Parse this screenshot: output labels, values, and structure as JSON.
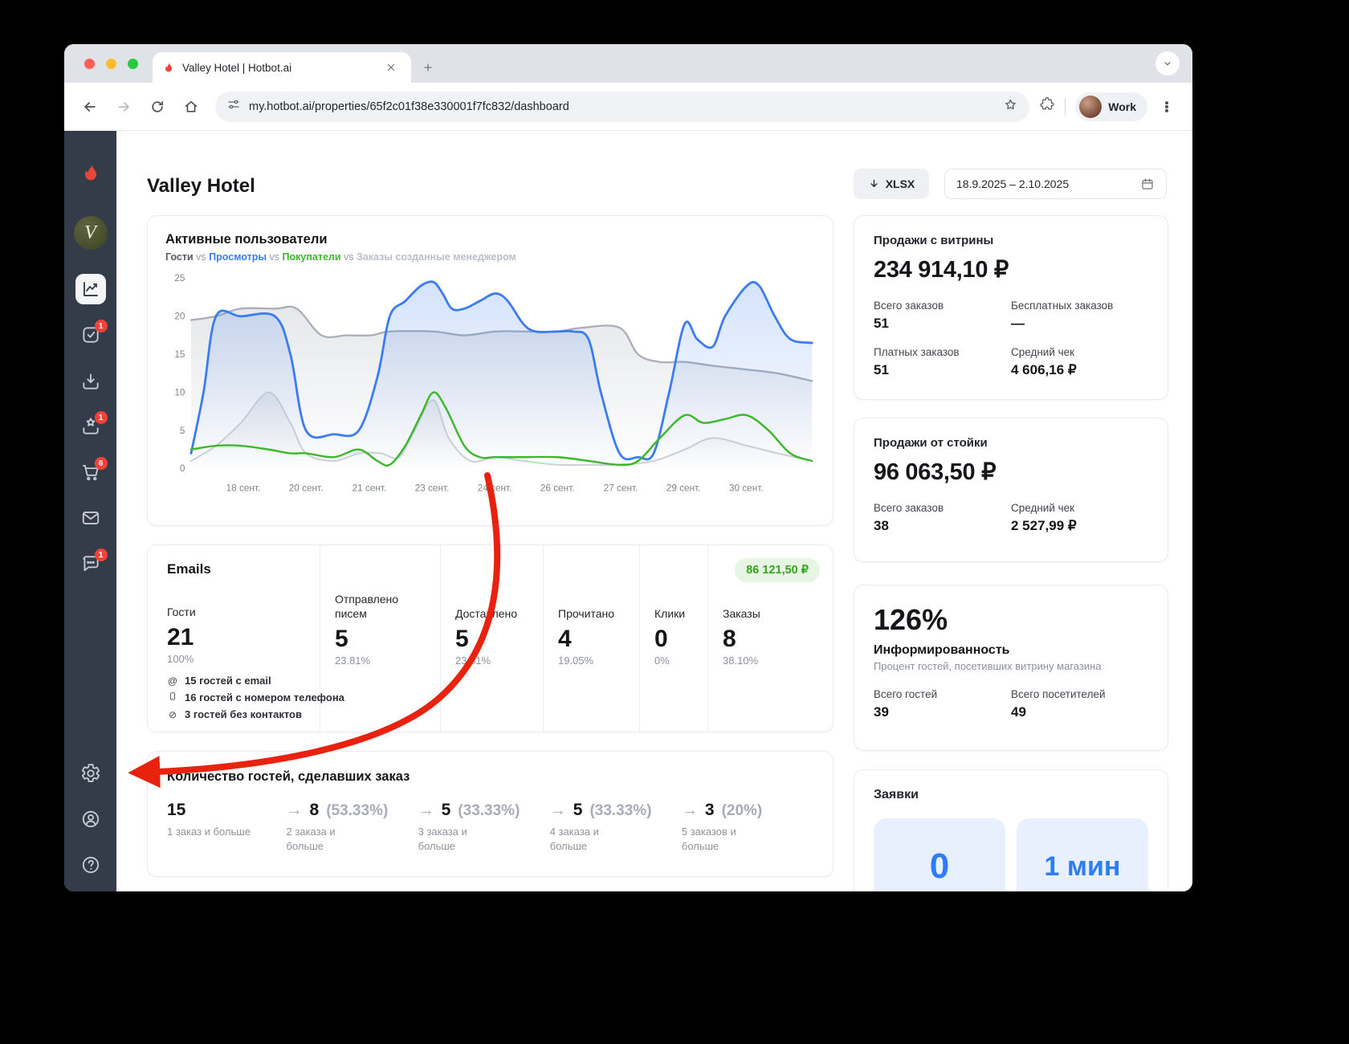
{
  "browser": {
    "tab_title": "Valley Hotel | Hotbot.ai",
    "url": "my.hotbot.ai/properties/65f2c01f38e330001f7fc832/dashboard",
    "profile_label": "Work"
  },
  "sidebar": {
    "v_label": "V",
    "badge_tasks": "1",
    "badge_reviews": "1",
    "badge_cart": "6",
    "badge_chat": "1"
  },
  "header": {
    "title": "Valley Hotel",
    "export_label": "XLSX",
    "date_range": "18.9.2025 – 2.10.2025"
  },
  "chart_data": {
    "type": "line",
    "title": "Активные пользователи",
    "vs_label": "vs",
    "ylim": [
      0,
      25
    ],
    "y_ticks": [
      0,
      5,
      10,
      15,
      20,
      25
    ],
    "x_ticks": [
      {
        "label": "18 сент.",
        "pos": 0.084
      },
      {
        "label": "20 сент.",
        "pos": 0.185
      },
      {
        "label": "21 сент.",
        "pos": 0.287
      },
      {
        "label": "23 сент.",
        "pos": 0.388
      },
      {
        "label": "24 сент.",
        "pos": 0.489
      },
      {
        "label": "26 сент.",
        "pos": 0.59
      },
      {
        "label": "27 сент.",
        "pos": 0.692
      },
      {
        "label": "29 сент.",
        "pos": 0.793
      },
      {
        "label": "30 сент.",
        "pos": 0.894
      }
    ],
    "series": [
      {
        "name": "Гости",
        "color": "#aab0ba",
        "legend_color": "#555b66",
        "width": 2.5,
        "z": 1,
        "fill": "url(#gradGray)",
        "points": [
          [
            0,
            19.5
          ],
          [
            0.04,
            20
          ],
          [
            0.08,
            21
          ],
          [
            0.135,
            21
          ],
          [
            0.17,
            21
          ],
          [
            0.21,
            17.5
          ],
          [
            0.25,
            17.5
          ],
          [
            0.29,
            17.5
          ],
          [
            0.32,
            18
          ],
          [
            0.39,
            18
          ],
          [
            0.44,
            17.5
          ],
          [
            0.49,
            18
          ],
          [
            0.545,
            18
          ],
          [
            0.59,
            18
          ],
          [
            0.63,
            18.5
          ],
          [
            0.69,
            18.5
          ],
          [
            0.72,
            15
          ],
          [
            0.755,
            14
          ],
          [
            0.795,
            14
          ],
          [
            0.84,
            13.5
          ],
          [
            0.895,
            13
          ],
          [
            0.945,
            12.5
          ],
          [
            1,
            11.5
          ]
        ]
      },
      {
        "name": "Просмотры",
        "color": "#3b7df0",
        "legend_color": "#3b7df0",
        "width": 3,
        "z": 3,
        "fill": "url(#gradBlue)",
        "points": [
          [
            0,
            2
          ],
          [
            0.02,
            10
          ],
          [
            0.04,
            20
          ],
          [
            0.08,
            20
          ],
          [
            0.135,
            20
          ],
          [
            0.16,
            15
          ],
          [
            0.185,
            5
          ],
          [
            0.23,
            4.5
          ],
          [
            0.27,
            5
          ],
          [
            0.3,
            12
          ],
          [
            0.32,
            20
          ],
          [
            0.345,
            22
          ],
          [
            0.37,
            24
          ],
          [
            0.39,
            24.5
          ],
          [
            0.405,
            23
          ],
          [
            0.42,
            21
          ],
          [
            0.44,
            21
          ],
          [
            0.465,
            22
          ],
          [
            0.49,
            23
          ],
          [
            0.51,
            22
          ],
          [
            0.535,
            19
          ],
          [
            0.555,
            18
          ],
          [
            0.59,
            18
          ],
          [
            0.615,
            18
          ],
          [
            0.64,
            17
          ],
          [
            0.66,
            10
          ],
          [
            0.69,
            2
          ],
          [
            0.72,
            1.5
          ],
          [
            0.745,
            2
          ],
          [
            0.77,
            10
          ],
          [
            0.795,
            19
          ],
          [
            0.815,
            17
          ],
          [
            0.84,
            16
          ],
          [
            0.86,
            20
          ],
          [
            0.895,
            24
          ],
          [
            0.915,
            24
          ],
          [
            0.94,
            20
          ],
          [
            0.965,
            17
          ],
          [
            1,
            16.5
          ]
        ]
      },
      {
        "name": "Покупатели",
        "color": "#3cb82c",
        "legend_color": "#3cb82c",
        "width": 2.6,
        "z": 4,
        "fill": "",
        "points": [
          [
            0,
            2.5
          ],
          [
            0.04,
            3
          ],
          [
            0.08,
            3
          ],
          [
            0.125,
            2.5
          ],
          [
            0.16,
            2
          ],
          [
            0.185,
            2
          ],
          [
            0.23,
            1.5
          ],
          [
            0.27,
            2.5
          ],
          [
            0.3,
            1
          ],
          [
            0.32,
            0.5
          ],
          [
            0.345,
            3
          ],
          [
            0.37,
            7
          ],
          [
            0.39,
            10
          ],
          [
            0.41,
            8
          ],
          [
            0.44,
            3
          ],
          [
            0.465,
            1.5
          ],
          [
            0.49,
            1.5
          ],
          [
            0.535,
            1.5
          ],
          [
            0.59,
            1.5
          ],
          [
            0.64,
            1
          ],
          [
            0.69,
            0.5
          ],
          [
            0.72,
            1
          ],
          [
            0.755,
            4
          ],
          [
            0.795,
            7
          ],
          [
            0.825,
            6
          ],
          [
            0.86,
            6.5
          ],
          [
            0.895,
            7
          ],
          [
            0.93,
            5
          ],
          [
            0.965,
            2
          ],
          [
            1,
            1
          ]
        ]
      },
      {
        "name": "Заказы созданные менеджером",
        "color": "#cdd1d8",
        "legend_color": "#b9bfc8",
        "width": 2.2,
        "z": 2,
        "fill": "url(#gradLight)",
        "points": [
          [
            0,
            1
          ],
          [
            0.04,
            3
          ],
          [
            0.08,
            6
          ],
          [
            0.125,
            10
          ],
          [
            0.16,
            6
          ],
          [
            0.185,
            2
          ],
          [
            0.23,
            1
          ],
          [
            0.27,
            2
          ],
          [
            0.305,
            2
          ],
          [
            0.335,
            1.5
          ],
          [
            0.36,
            5
          ],
          [
            0.39,
            9
          ],
          [
            0.415,
            4
          ],
          [
            0.45,
            1
          ],
          [
            0.49,
            1.5
          ],
          [
            0.535,
            1
          ],
          [
            0.59,
            0.5
          ],
          [
            0.64,
            0.5
          ],
          [
            0.69,
            0.5
          ],
          [
            0.745,
            1
          ],
          [
            0.795,
            2.5
          ],
          [
            0.84,
            4
          ],
          [
            0.895,
            3
          ],
          [
            0.945,
            2
          ],
          [
            1,
            1
          ]
        ]
      }
    ]
  },
  "emails": {
    "title": "Emails",
    "badge": "86 121,50 ₽",
    "metrics": [
      {
        "label": "Гости",
        "value": "21",
        "percent": "100%"
      },
      {
        "label": "Отправлено писем",
        "value": "5",
        "percent": "23.81%"
      },
      {
        "label": "Доставлено",
        "value": "5",
        "percent": "23.81%"
      },
      {
        "label": "Прочитано",
        "value": "4",
        "percent": "19.05%"
      },
      {
        "label": "Клики",
        "value": "0",
        "percent": "0%"
      },
      {
        "label": "Заказы",
        "value": "8",
        "percent": "38.10%"
      }
    ],
    "contacts": [
      {
        "icon": "at",
        "text": "15 гостей с email"
      },
      {
        "icon": "phone",
        "text": "16 гостей с номером телефона"
      },
      {
        "icon": "no-contact",
        "text": "3 гостей без контактов"
      }
    ]
  },
  "funnel": {
    "title": "Количество гостей, сделавших заказ",
    "arrow": "→",
    "steps": [
      {
        "value": "15",
        "percent": "",
        "label": "1 заказ и больше"
      },
      {
        "value": "8",
        "percent": "(53.33%)",
        "label": "2 заказа и больше"
      },
      {
        "value": "5",
        "percent": "(33.33%)",
        "label": "3 заказа и больше"
      },
      {
        "value": "5",
        "percent": "(33.33%)",
        "label": "4 заказа и больше"
      },
      {
        "value": "3",
        "percent": "(20%)",
        "label": "5 заказов и больше"
      }
    ]
  },
  "cards": {
    "showcase": {
      "title": "Продажи с витрины",
      "total": "234 914,10 ₽",
      "stats": [
        {
          "label": "Всего заказов",
          "value": "51"
        },
        {
          "label": "Бесплатных заказов",
          "value": "—"
        },
        {
          "label": "Платных заказов",
          "value": "51"
        },
        {
          "label": "Средний чек",
          "value": "4 606,16 ₽"
        }
      ]
    },
    "desk": {
      "title": "Продажи от стойки",
      "total": "96 063,50 ₽",
      "stats": [
        {
          "label": "Всего заказов",
          "value": "38"
        },
        {
          "label": "Средний чек",
          "value": "2 527,99 ₽"
        }
      ]
    },
    "awareness": {
      "value": "126%",
      "title": "Информированность",
      "subtitle": "Процент гостей, посетивших витрину магазина",
      "stats": [
        {
          "label": "Всего гостей",
          "value": "39"
        },
        {
          "label": "Всего посетителей",
          "value": "49"
        }
      ]
    },
    "requests": {
      "title": "Заявки",
      "tiles": [
        "0",
        "1 мин"
      ]
    }
  }
}
